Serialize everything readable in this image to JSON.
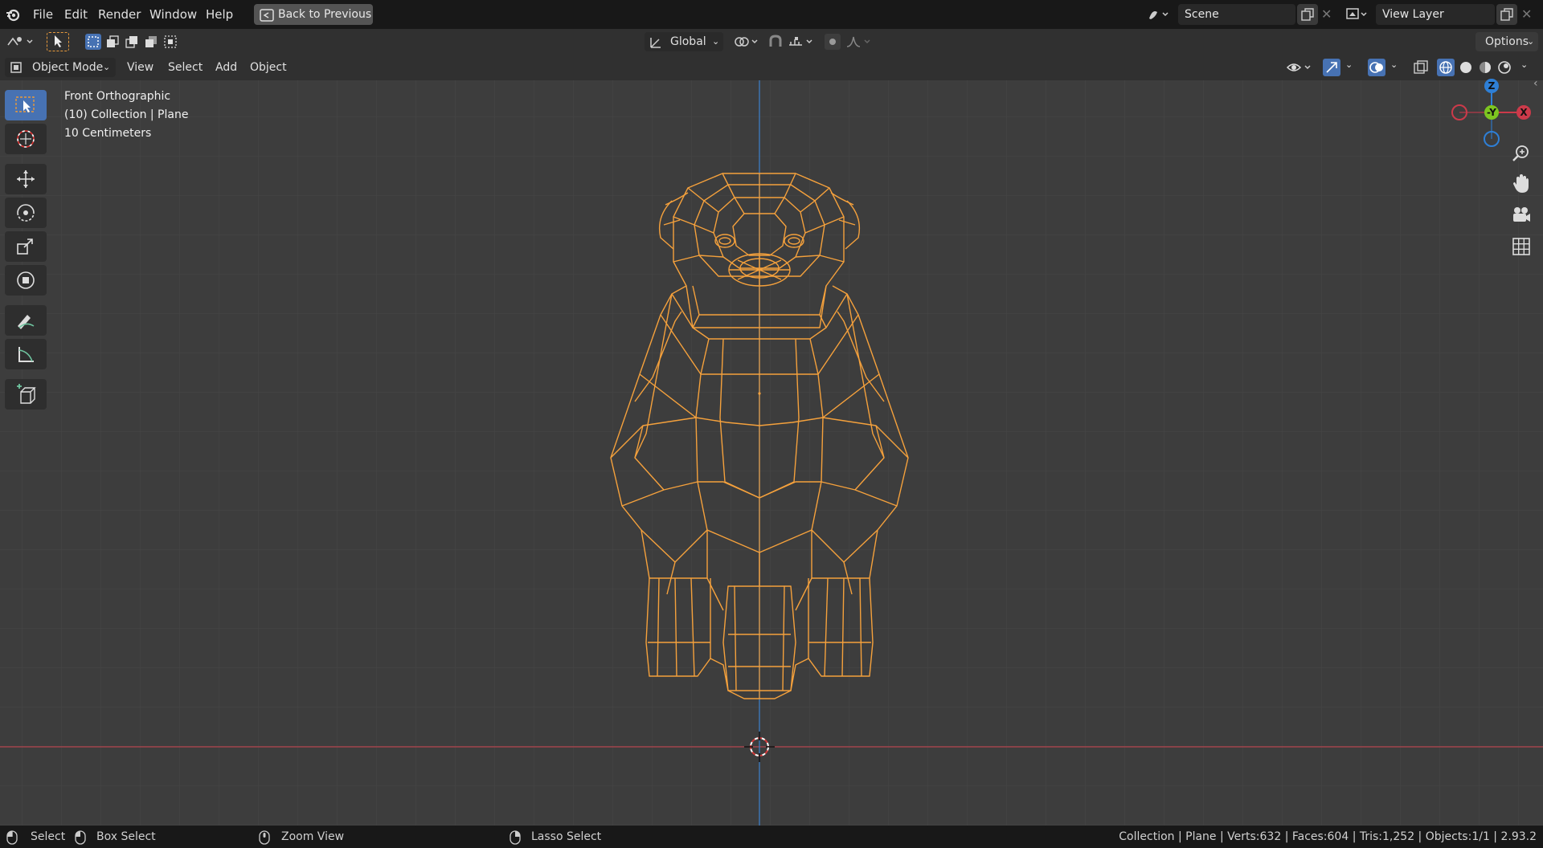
{
  "topbar": {
    "menus": [
      "File",
      "Edit",
      "Render",
      "Window",
      "Help"
    ],
    "back_button": "Back to Previous",
    "scene": {
      "value": "Scene"
    },
    "view_layer": {
      "value": "View Layer"
    }
  },
  "toolheader": {
    "orientation": "Global",
    "options": "Options"
  },
  "viewport_header": {
    "mode": "Object Mode",
    "menus": [
      "View",
      "Select",
      "Add",
      "Object"
    ]
  },
  "overlay": {
    "view_name": "Front Orthographic",
    "collection": "(10) Collection | Plane",
    "scale": "10 Centimeters"
  },
  "gizmo": {
    "z": "Z",
    "y": "-Y",
    "x": "X"
  },
  "statusbar": {
    "select": "Select",
    "box_select": "Box Select",
    "zoom_view": "Zoom View",
    "lasso_select": "Lasso Select",
    "stats": "Collection | Plane | Verts:632 | Faces:604 | Tris:1,252 | Objects:1/1 | 2.93.2"
  },
  "colors": {
    "accent": "#4772b3",
    "wire": "#f5a13c",
    "x_axis": "#cc3a4a",
    "z_axis": "#2e7fd6",
    "y_axis": "#7dc620"
  }
}
